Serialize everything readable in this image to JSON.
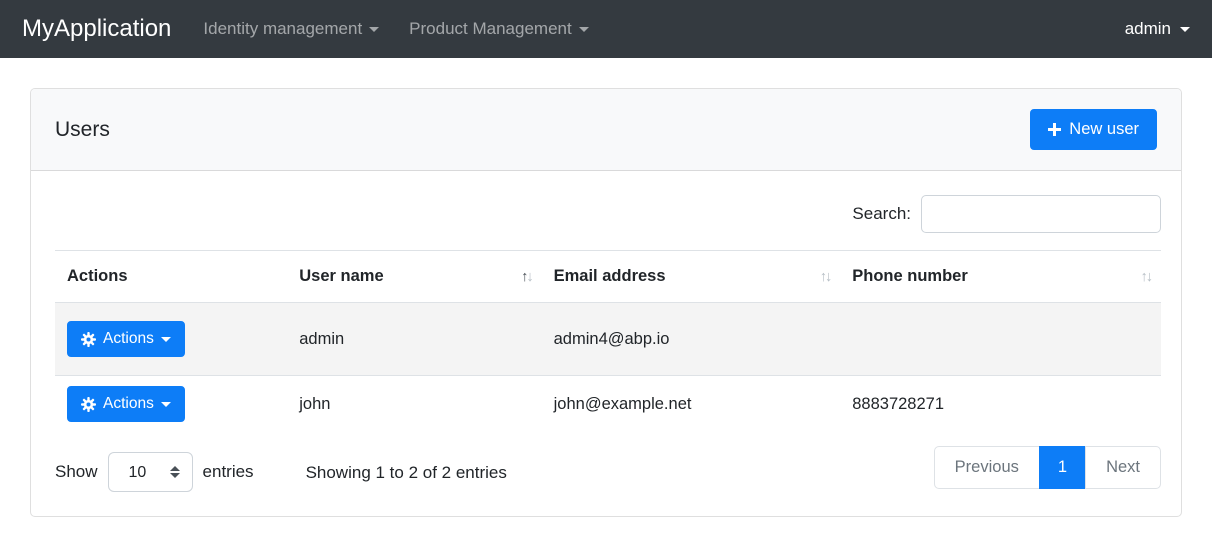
{
  "navbar": {
    "brand": "MyApplication",
    "menus": [
      {
        "label": "Identity management"
      },
      {
        "label": "Product Management"
      }
    ],
    "user": "admin"
  },
  "card": {
    "title": "Users",
    "new_user_label": "New user"
  },
  "search": {
    "label": "Search:",
    "value": ""
  },
  "table": {
    "columns": [
      {
        "label": "Actions",
        "sortable": false,
        "sort": "none"
      },
      {
        "label": "User name",
        "sortable": true,
        "sort": "asc"
      },
      {
        "label": "Email address",
        "sortable": true,
        "sort": "none"
      },
      {
        "label": "Phone number",
        "sortable": true,
        "sort": "none"
      }
    ],
    "action_button_label": "Actions",
    "rows": [
      {
        "user_name": "admin",
        "email": "admin4@abp.io",
        "phone": ""
      },
      {
        "user_name": "john",
        "email": "john@example.net",
        "phone": "8883728271"
      }
    ]
  },
  "footer": {
    "show_label": "Show",
    "page_size": "10",
    "entries_label": "entries",
    "info": "Showing 1 to 2 of 2 entries",
    "pagination": {
      "previous": "Previous",
      "current": "1",
      "next": "Next"
    }
  },
  "icons": {
    "sort_up": "↑",
    "sort_down": "↓"
  },
  "colors": {
    "primary": "#0d7df7",
    "navbar_bg": "#343a40",
    "card_header_bg": "#f8f9fa",
    "stripe_bg": "#eff0f0",
    "table_border": "#dee2e6",
    "muted_text": "#6c757d",
    "text": "#212529"
  }
}
